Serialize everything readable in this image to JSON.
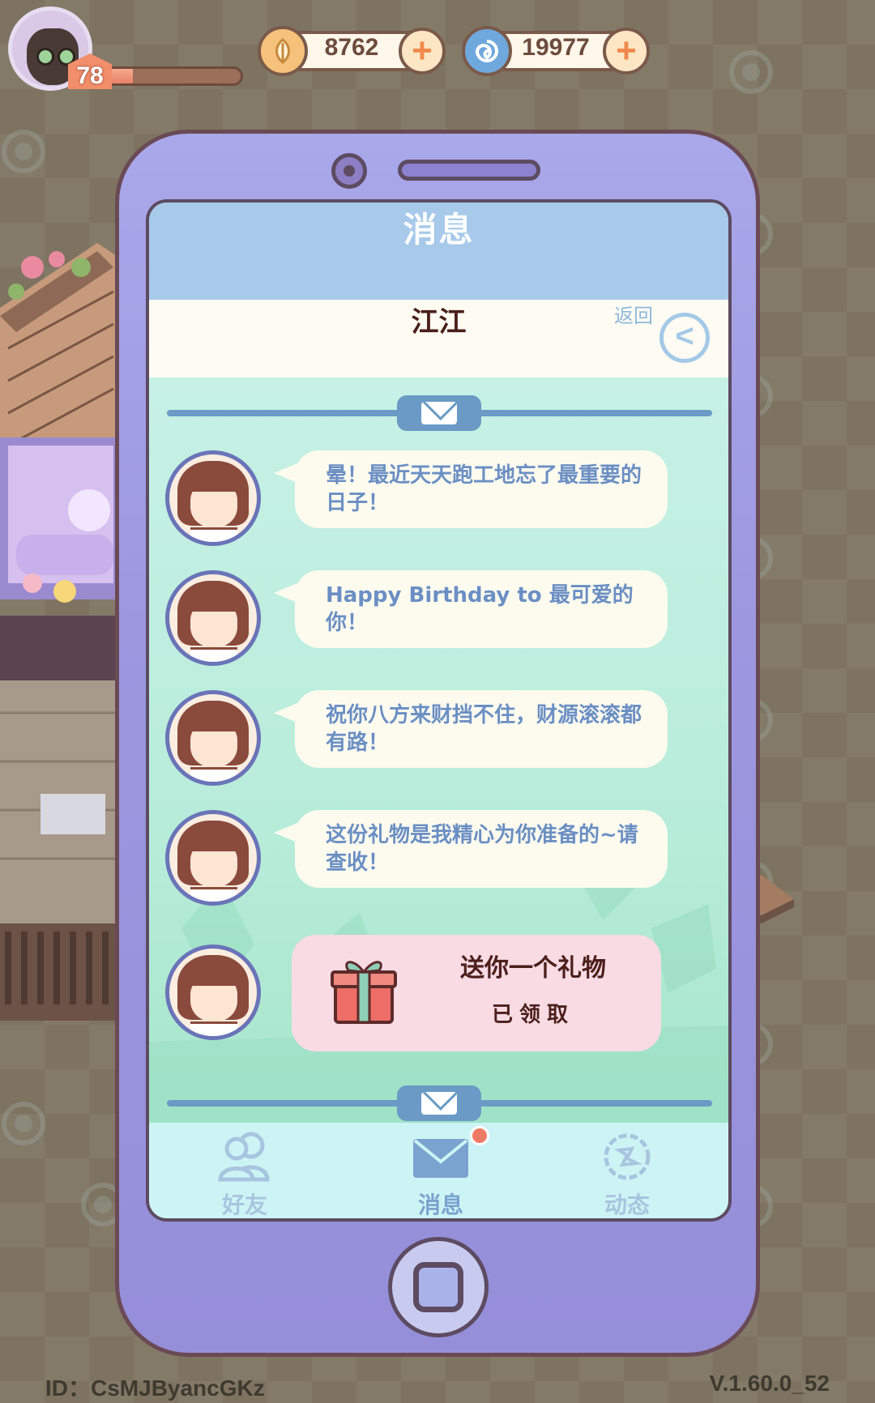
{
  "player": {
    "level": "78",
    "xp_progress": 0.22
  },
  "currencies": [
    {
      "name": "leaf-coin",
      "value": "8762",
      "color": "#f6c17a"
    },
    {
      "name": "swirl-gem",
      "value": "19977",
      "color": "#6fa8dc"
    }
  ],
  "screen": {
    "title": "消息",
    "contact_name": "江江",
    "back_label": "返回"
  },
  "messages": [
    {
      "text": "晕！最近天天跑工地忘了最重要的日子！"
    },
    {
      "text": "Happy Birthday to 最可爱的你！"
    },
    {
      "text": "祝你八方来财挡不住，财源滚滚都有路！"
    },
    {
      "text": "这份礼物是我精心为你准备的~请查收！"
    }
  ],
  "gift": {
    "title": "送你一个礼物",
    "status": "已领取"
  },
  "tabs": [
    {
      "label": "好友",
      "icon": "friends-icon"
    },
    {
      "label": "消息",
      "icon": "mail-icon",
      "active": true,
      "has_notification": true
    },
    {
      "label": "动态",
      "icon": "moments-icon"
    }
  ],
  "footer": {
    "id_text": "ID：CsMJByancGKz",
    "version": "V.1.60.0_52"
  }
}
